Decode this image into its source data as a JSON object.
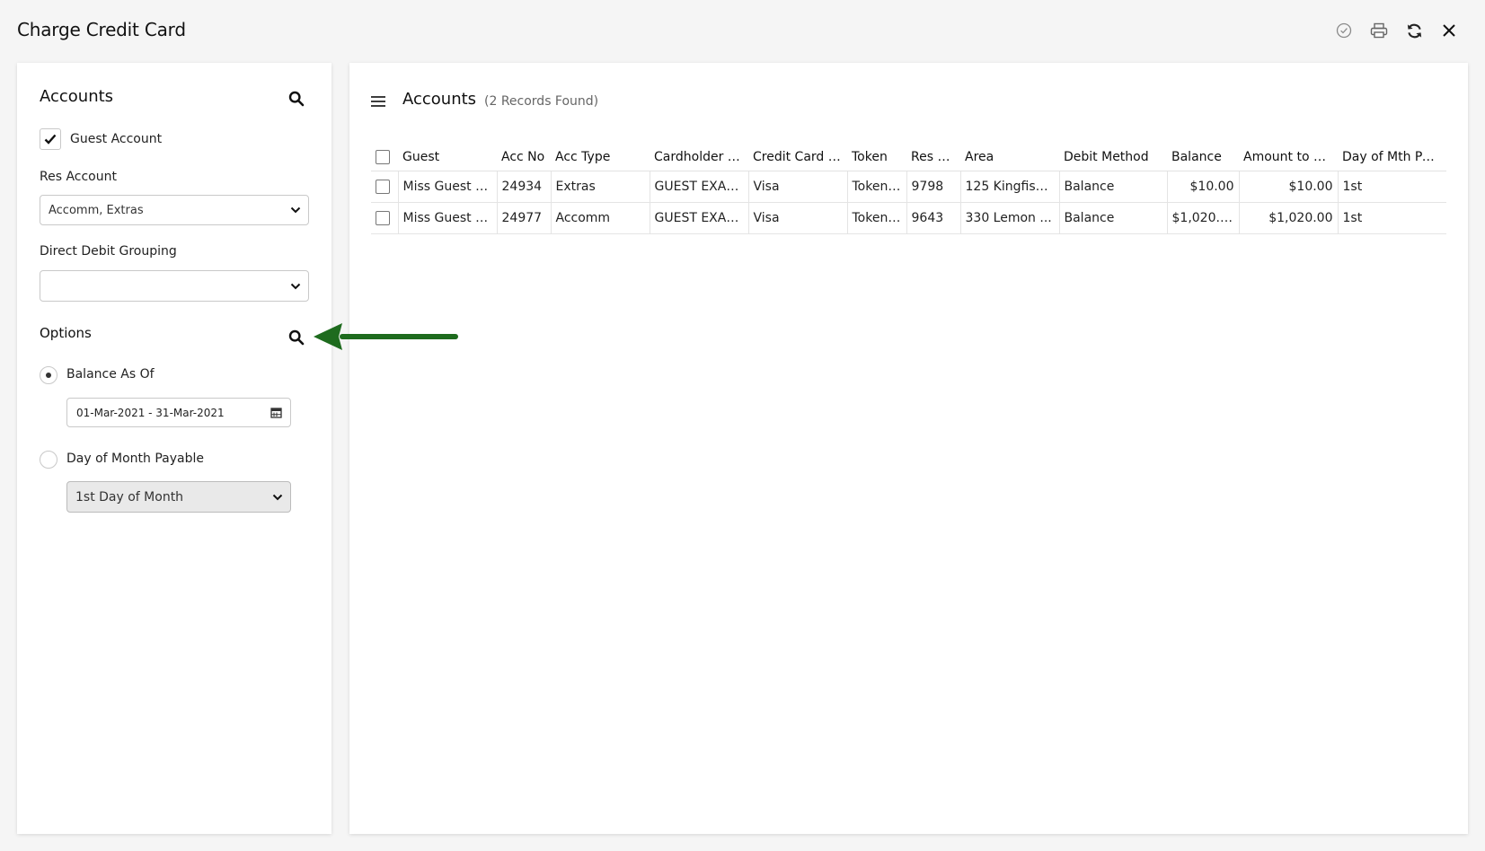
{
  "window": {
    "title": "Charge Credit Card"
  },
  "toolbar": {
    "icons": [
      "check-circle-icon",
      "print-icon",
      "refresh-icon",
      "close-icon"
    ]
  },
  "filters": {
    "accounts_title": "Accounts",
    "guest_account_label": "Guest Account",
    "guest_account_checked": true,
    "res_account_label": "Res Account",
    "res_account_value": "Accomm, Extras",
    "direct_debit_label": "Direct Debit Grouping",
    "direct_debit_value": "",
    "options_title": "Options",
    "balance_as_of_label": "Balance As Of",
    "balance_as_of_selected": true,
    "date_range_value": "01-Mar-2021 - 31-Mar-2021",
    "day_of_month_label": "Day of Month Payable",
    "day_of_month_selected": false,
    "day_of_month_value": "1st Day of Month"
  },
  "results": {
    "title": "Accounts",
    "count_text": "(2 Records Found)",
    "columns": [
      "Guest",
      "Acc No",
      "Acc Type",
      "Cardholder N...",
      "Credit Card (...",
      "Token",
      "Res N...",
      "Area",
      "Debit Method",
      "Balance",
      "Amount to D...",
      "Day of Mth Pay..."
    ],
    "rows": [
      [
        "Miss Guest E...",
        "24934",
        "Extras",
        "GUEST EXAM...",
        "Visa",
        "Token ...",
        "9798",
        "125 Kingfishe...",
        "Balance",
        "$10.00",
        "$10.00",
        "1st"
      ],
      [
        "Miss Guest E...",
        "24977",
        "Accomm",
        "GUEST EXAM...",
        "Visa",
        "Token ...",
        "9643",
        "330 Lemon ...",
        "Balance",
        "$1,020.00",
        "$1,020.00",
        "1st"
      ]
    ]
  },
  "colors": {
    "accent_arrow": "#1e6b1e",
    "background": "#f5f5f5",
    "panel": "#ffffff"
  }
}
